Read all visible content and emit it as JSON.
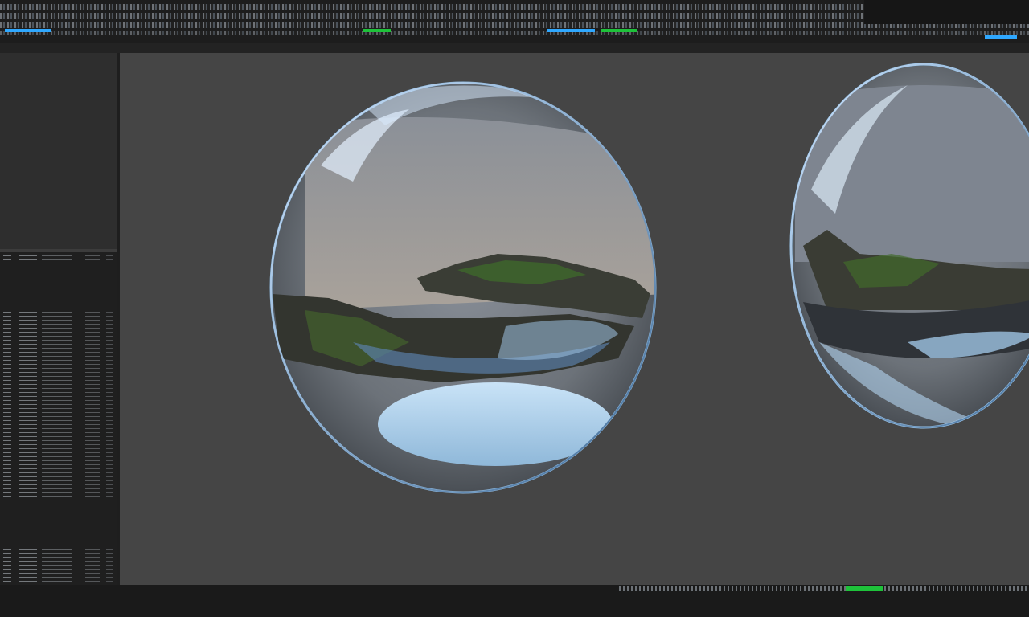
{
  "app": {
    "title": ""
  },
  "menubar": {
    "label": ""
  },
  "outliner": {
    "title": ""
  },
  "viewport": {
    "objects": [
      "glass-sphere",
      "glass-sphere"
    ]
  },
  "statusbar": {
    "text": ""
  },
  "colors": {
    "viewport_bg": "#454545",
    "panel_bg": "#2f2f2f",
    "accent_green": "#1ec23a",
    "accent_blue": "#2fa8ff"
  }
}
